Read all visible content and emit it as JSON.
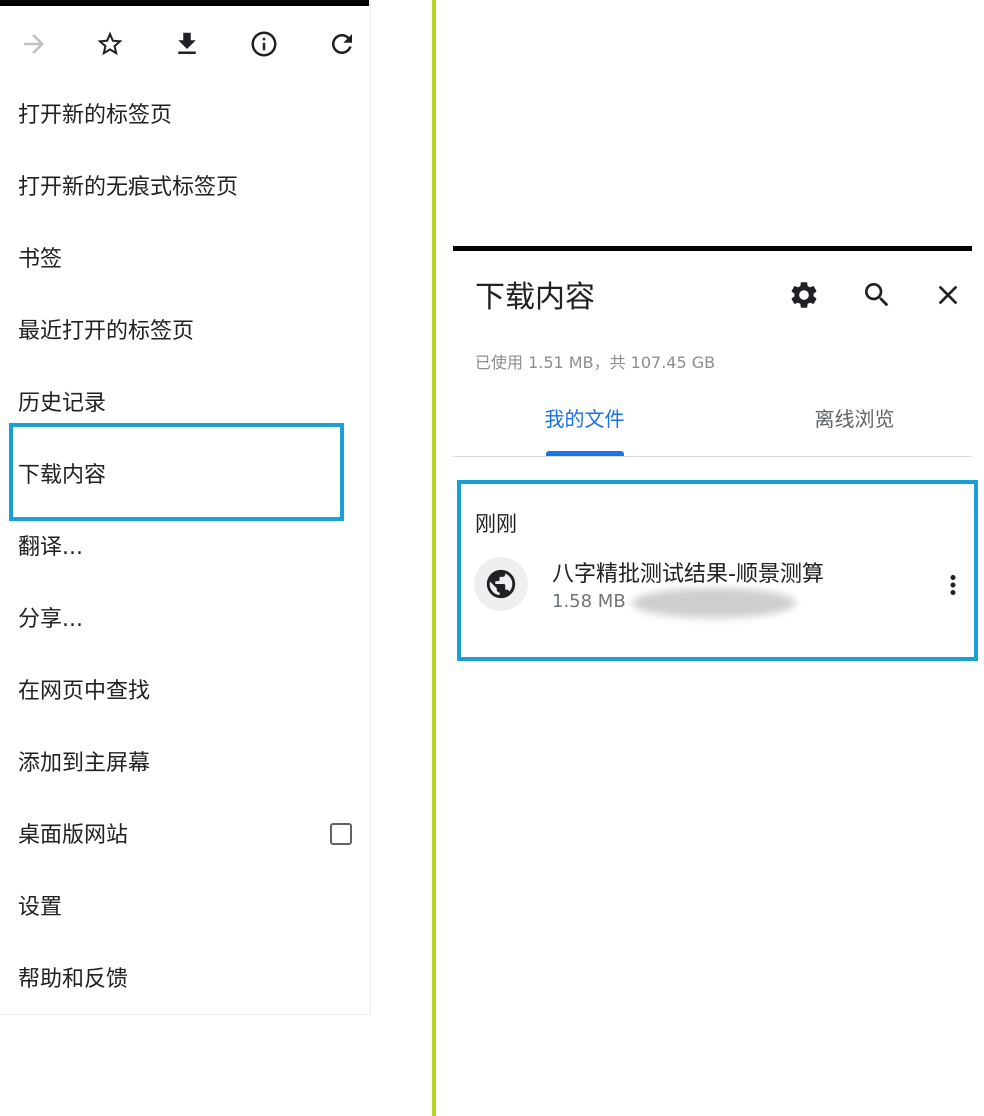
{
  "left_menu": {
    "toolbar": {
      "icons": [
        "forward-icon",
        "star-icon",
        "download-icon",
        "info-icon",
        "refresh-icon"
      ]
    },
    "items": [
      {
        "label": "打开新的标签页"
      },
      {
        "label": "打开新的无痕式标签页"
      },
      {
        "label": "书签"
      },
      {
        "label": "最近打开的标签页"
      },
      {
        "label": "历史记录"
      },
      {
        "label": "下载内容"
      },
      {
        "label": "翻译..."
      },
      {
        "label": "分享..."
      },
      {
        "label": "在网页中查找"
      },
      {
        "label": "添加到主屏幕"
      },
      {
        "label": "桌面版网站",
        "checked": false
      },
      {
        "label": "设置"
      },
      {
        "label": "帮助和反馈"
      }
    ]
  },
  "downloads": {
    "title": "下载内容",
    "storage": "已使用 1.51 MB，共 107.45 GB",
    "tabs": [
      {
        "label": "我的文件",
        "active": true
      },
      {
        "label": "离线浏览",
        "active": false
      }
    ],
    "section_label": "刚刚",
    "file": {
      "name": "八字精批测试结果-顺景测算",
      "size": "1.58 MB",
      "icon": "globe-icon"
    }
  },
  "colors": {
    "highlight": "#1a9fd6",
    "divider": "#b5d923",
    "accent": "#1a73e8"
  }
}
